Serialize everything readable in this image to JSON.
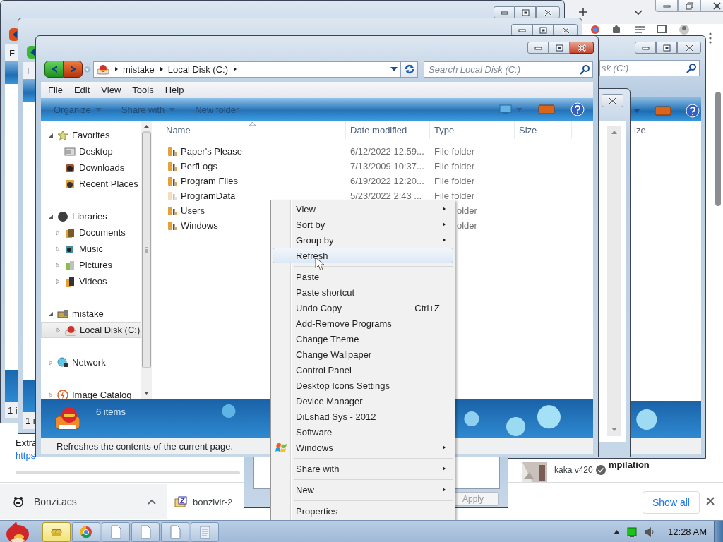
{
  "browser": {
    "page_text": "Extra",
    "page_link": "https",
    "video_title_fragment": "mpilation",
    "channel": "kaka v420",
    "downloads": [
      {
        "name": "Bonzi.acs",
        "hovered": true
      },
      {
        "name": "bonzivir-2",
        "hovered": false
      }
    ],
    "show_all": "Show all"
  },
  "back_windows": [
    {
      "menu_fragment": "F",
      "status_fragment": "1 i"
    },
    {
      "menu_fragment": "F",
      "status_fragment": "1 i"
    }
  ],
  "right_window": {
    "search_fragment": "sk (C:)",
    "column_fragment": "ize"
  },
  "dialog": {
    "button": "Apply"
  },
  "explorer": {
    "path": [
      "mistake",
      "Local Disk (C:)"
    ],
    "search_placeholder": "Search Local Disk (C:)",
    "menu": [
      "File",
      "Edit",
      "View",
      "Tools",
      "Help"
    ],
    "toolbar": [
      {
        "label": "Organize",
        "dropdown": true
      },
      {
        "label": "Share with",
        "dropdown": true
      },
      {
        "label": "New folder",
        "dropdown": false
      }
    ],
    "nav": [
      {
        "label": "Favorites",
        "kind": "branch",
        "expanded": true,
        "selected": false,
        "children": [
          {
            "label": "Desktop",
            "kind": "leaf",
            "selected": false
          },
          {
            "label": "Downloads",
            "kind": "leaf",
            "selected": false
          },
          {
            "label": "Recent Places",
            "kind": "leaf",
            "selected": false
          }
        ]
      },
      {
        "label": "Libraries",
        "kind": "branch",
        "expanded": true,
        "selected": false,
        "children": [
          {
            "label": "Documents",
            "kind": "branch",
            "expanded": false,
            "selected": false
          },
          {
            "label": "Music",
            "kind": "branch",
            "expanded": false,
            "selected": false
          },
          {
            "label": "Pictures",
            "kind": "branch",
            "expanded": false,
            "selected": false
          },
          {
            "label": "Videos",
            "kind": "branch",
            "expanded": false,
            "selected": false
          }
        ]
      },
      {
        "label": "mistake",
        "kind": "branch",
        "expanded": true,
        "selected": false,
        "children": [
          {
            "label": "Local Disk (C:)",
            "kind": "branch",
            "expanded": false,
            "selected": true
          }
        ]
      },
      {
        "label": "Network",
        "kind": "branch",
        "expanded": false,
        "selected": false
      },
      {
        "label": "Image Catalog",
        "kind": "branch",
        "expanded": false,
        "selected": false
      }
    ],
    "columns": [
      "Name",
      "Date modified",
      "Type",
      "Size"
    ],
    "rows": [
      {
        "name": "Paper's Please",
        "date": "6/12/2022 12:59...",
        "type": "File folder",
        "hidden": false
      },
      {
        "name": "PerfLogs",
        "date": "7/13/2009 10:37...",
        "type": "File folder",
        "hidden": false
      },
      {
        "name": "Program Files",
        "date": "6/19/2022 12:20...",
        "type": "File folder",
        "hidden": false
      },
      {
        "name": "ProgramData",
        "date": "5/23/2022 2:43 ...",
        "type": "File folder",
        "hidden": true
      },
      {
        "name": "Users",
        "type": "older",
        "hidden": false
      },
      {
        "name": "Windows",
        "type": "older",
        "hidden": false
      }
    ],
    "item_count": "6 items",
    "status": "Refreshes the contents of the current page."
  },
  "context_menu": [
    {
      "kind": "item",
      "label": "View",
      "submenu": true,
      "highlighted": false
    },
    {
      "kind": "item",
      "label": "Sort by",
      "submenu": true,
      "highlighted": false
    },
    {
      "kind": "item",
      "label": "Group by",
      "submenu": true,
      "highlighted": false
    },
    {
      "kind": "item",
      "label": "Refresh",
      "submenu": false,
      "highlighted": true
    },
    {
      "kind": "separator"
    },
    {
      "kind": "item",
      "label": "Paste",
      "submenu": false,
      "highlighted": false
    },
    {
      "kind": "item",
      "label": "Paste shortcut",
      "submenu": false,
      "highlighted": false
    },
    {
      "kind": "item",
      "label": "Undo Copy",
      "shortcut": "Ctrl+Z",
      "submenu": false,
      "highlighted": false
    },
    {
      "kind": "item",
      "label": "Add-Remove Programs",
      "submenu": false,
      "highlighted": false
    },
    {
      "kind": "item",
      "label": "Change Theme",
      "submenu": false,
      "highlighted": false
    },
    {
      "kind": "item",
      "label": "Change Wallpaper",
      "submenu": false,
      "highlighted": false
    },
    {
      "kind": "item",
      "label": "Control Panel",
      "submenu": false,
      "highlighted": false
    },
    {
      "kind": "item",
      "label": "Desktop Icons Settings",
      "submenu": false,
      "highlighted": false
    },
    {
      "kind": "item",
      "label": "Device Manager",
      "submenu": false,
      "highlighted": false
    },
    {
      "kind": "item",
      "label": "DiLshad Sys - 2012",
      "submenu": false,
      "highlighted": false
    },
    {
      "kind": "item",
      "label": "Software",
      "submenu": false,
      "highlighted": false
    },
    {
      "kind": "item",
      "label": "Windows",
      "submenu": true,
      "highlighted": false,
      "has_icon": true
    },
    {
      "kind": "separator"
    },
    {
      "kind": "item",
      "label": "Share with",
      "submenu": true,
      "highlighted": false
    },
    {
      "kind": "separator"
    },
    {
      "kind": "item",
      "label": "New",
      "submenu": true,
      "highlighted": false
    },
    {
      "kind": "separator"
    },
    {
      "kind": "item",
      "label": "Properties",
      "submenu": false,
      "highlighted": false
    }
  ],
  "taskbar": {
    "buttons": [
      {
        "active": true
      },
      {
        "active": false
      },
      {
        "active": false
      },
      {
        "active": false
      },
      {
        "active": false
      },
      {
        "active": false
      }
    ],
    "clock": "12:28 AM"
  }
}
